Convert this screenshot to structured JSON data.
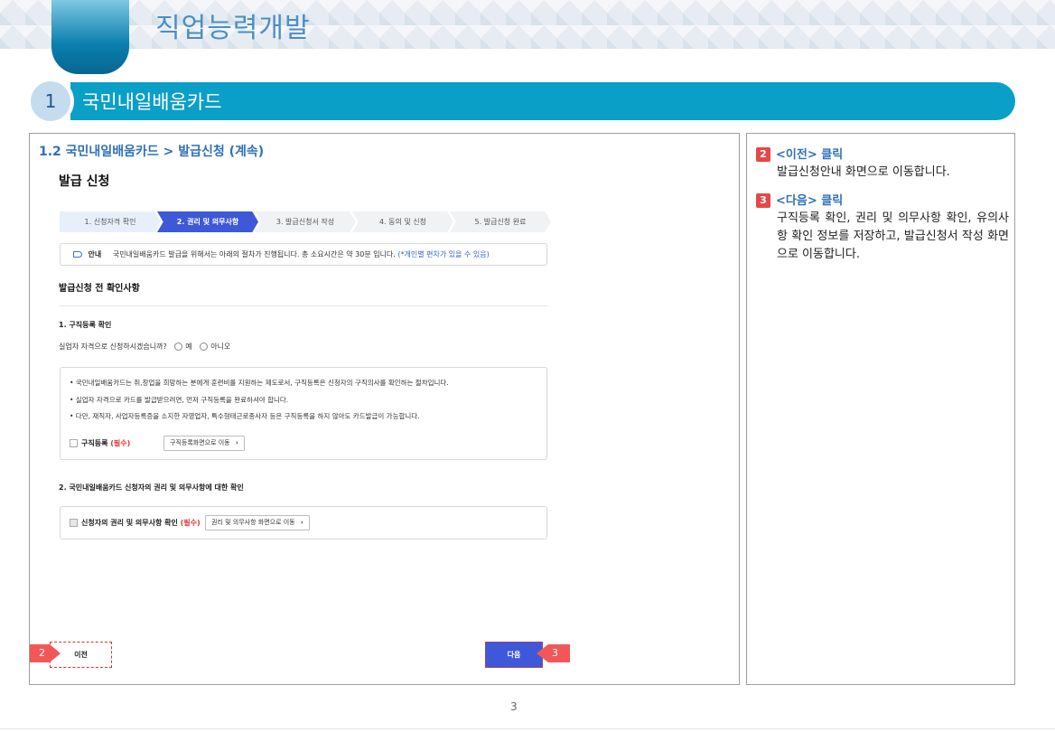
{
  "header": {
    "title": "직업능력개발"
  },
  "section": {
    "number": "1",
    "title": "국민내일배움카드"
  },
  "main": {
    "sub_heading": "1.2 국민내일배움카드 > 발급신청 (계속)",
    "page_heading": "발급 신청",
    "steps": [
      "1. 신청자격 확인",
      "2. 권리 및 의무사항",
      "3. 발급신청서 작성",
      "4. 동의 및 신청",
      "5. 발급신청 완료"
    ],
    "active_step_index": 1,
    "notice": {
      "tag": "안내",
      "text": "국민내일배움카드 발급을 위해서는 아래의 절차가 진행됩니다. 총 소요시간은 약 30분 입니다.",
      "highlight": "(*개인별 편차가 있을 수 있음)"
    },
    "check_title": "발급신청 전 확인사항",
    "q1": {
      "title": "1. 구직등록 확인",
      "question": "실업자 자격으로 신청하시겠습니까?",
      "option_yes": "예",
      "option_no": "아니오",
      "info_lines": [
        "• 국민내일배움카드는 취,창업을 희망하는 분에게 훈련비를 지원하는 제도로서, 구직등록은 신청자의 구직의사를 확인하는 절차입니다.",
        "• 실업자 자격으로 카드를 발급받으려면, 먼저 구직등록을 완료하셔야 합니다.",
        "• 다만, 재직자, 사업자등록증을 소지한 자영업자, 특수형태근로종사자 등은 구직등록을 하지 않아도 카드발급이 가능합니다."
      ],
      "req_label": "구직등록",
      "req_mark": "(필수)",
      "link_label": "구직등록화면으로 이동",
      "link_arrow": "›"
    },
    "q2": {
      "title": "2. 국민내일배움카드 신청자의 권리 및 의무사항에 대한 확인",
      "req_label": "신청자의 권리 및 의무사항 확인",
      "req_mark": "(필수)",
      "link_label": "권리 및 의무사항 화면으로 이동",
      "link_arrow": "›"
    },
    "prev_label": "이전",
    "next_label": "다음",
    "callout_prev": "2",
    "callout_next": "3"
  },
  "side": {
    "notes": [
      {
        "num": "2",
        "head": "<이전> 클릭",
        "body": "발급신청안내 화면으로 이동합니다."
      },
      {
        "num": "3",
        "head": "<다음> 클릭",
        "body": "구직등록 확인, 권리 및 의무사항 확인, 유의사항 확인 정보를 저장하고, 발급신청서 작성 화면으로 이동합니다."
      }
    ]
  },
  "footer": {
    "page_number": "3"
  },
  "colors": {
    "accent": "#0a9fc7",
    "primary_button": "#3d59d9",
    "callout": "#f25757",
    "heading_blue": "#2e72b8"
  }
}
